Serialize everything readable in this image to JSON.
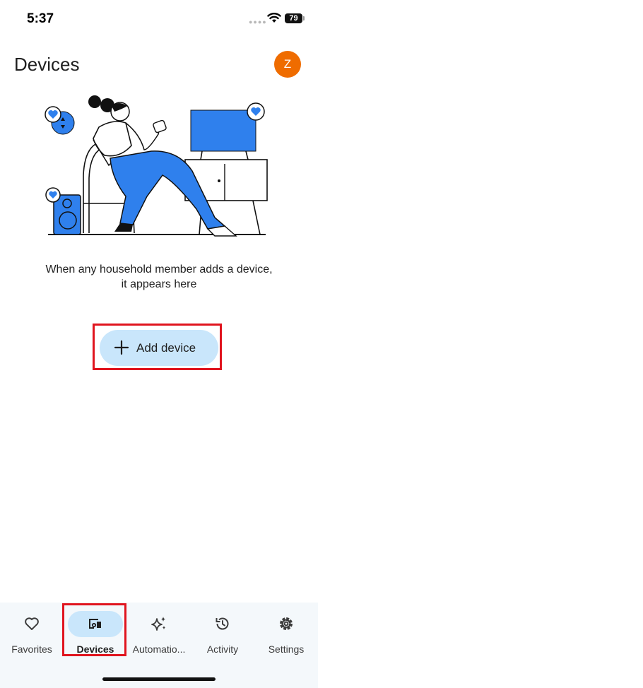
{
  "status": {
    "time": "5:37",
    "battery": "79"
  },
  "header": {
    "title": "Devices",
    "avatar_initial": "Z",
    "avatar_color": "#ef6c00"
  },
  "empty_state": {
    "line1": "When any household member adds a device,",
    "line2": "it appears here"
  },
  "add_button": {
    "label": "Add device",
    "icon": "plus-icon"
  },
  "nav": {
    "items": [
      {
        "label": "Favorites",
        "icon": "heart-icon",
        "active": false
      },
      {
        "label": "Devices",
        "icon": "devices-icon",
        "active": true
      },
      {
        "label": "Automatio...",
        "icon": "sparkle-icon",
        "active": false
      },
      {
        "label": "Activity",
        "icon": "history-icon",
        "active": false
      },
      {
        "label": "Settings",
        "icon": "gear-icon",
        "active": false
      }
    ]
  },
  "colors": {
    "accent_light": "#c9e6fb",
    "illustration_blue": "#2f80ed",
    "highlight_red": "#e0141e"
  }
}
